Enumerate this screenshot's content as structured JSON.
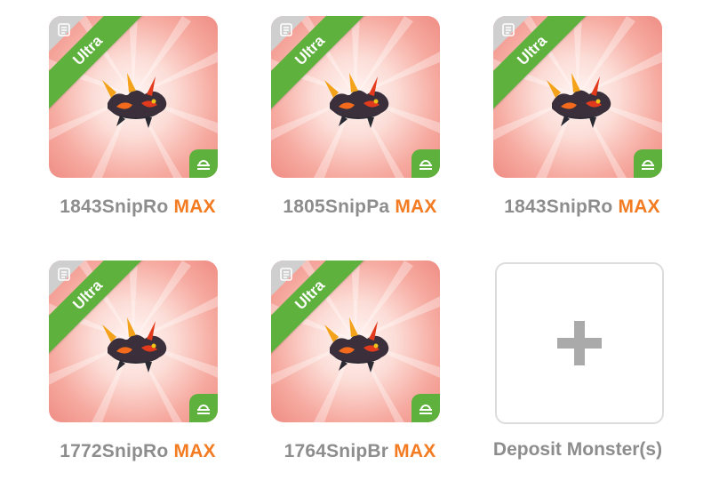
{
  "monsters": [
    {
      "name": "1843SnipRo",
      "level": "MAX",
      "rarity": "Ultra"
    },
    {
      "name": "1805SnipPa",
      "level": "MAX",
      "rarity": "Ultra"
    },
    {
      "name": "1843SnipRo",
      "level": "MAX",
      "rarity": "Ultra"
    },
    {
      "name": "1772SnipRo",
      "level": "MAX",
      "rarity": "Ultra"
    },
    {
      "name": "1764SnipBr",
      "level": "MAX",
      "rarity": "Ultra"
    }
  ],
  "deposit": {
    "label": "Deposit Monster(s)"
  },
  "icons": {
    "corner": "document-icon",
    "element": "libra-icon",
    "add": "plus-icon"
  },
  "colors": {
    "ultra_ribbon": "#5fb13e",
    "max_text": "#f37b22",
    "label_text": "#8d8d8d",
    "card_bg": "#f6aaa0"
  }
}
